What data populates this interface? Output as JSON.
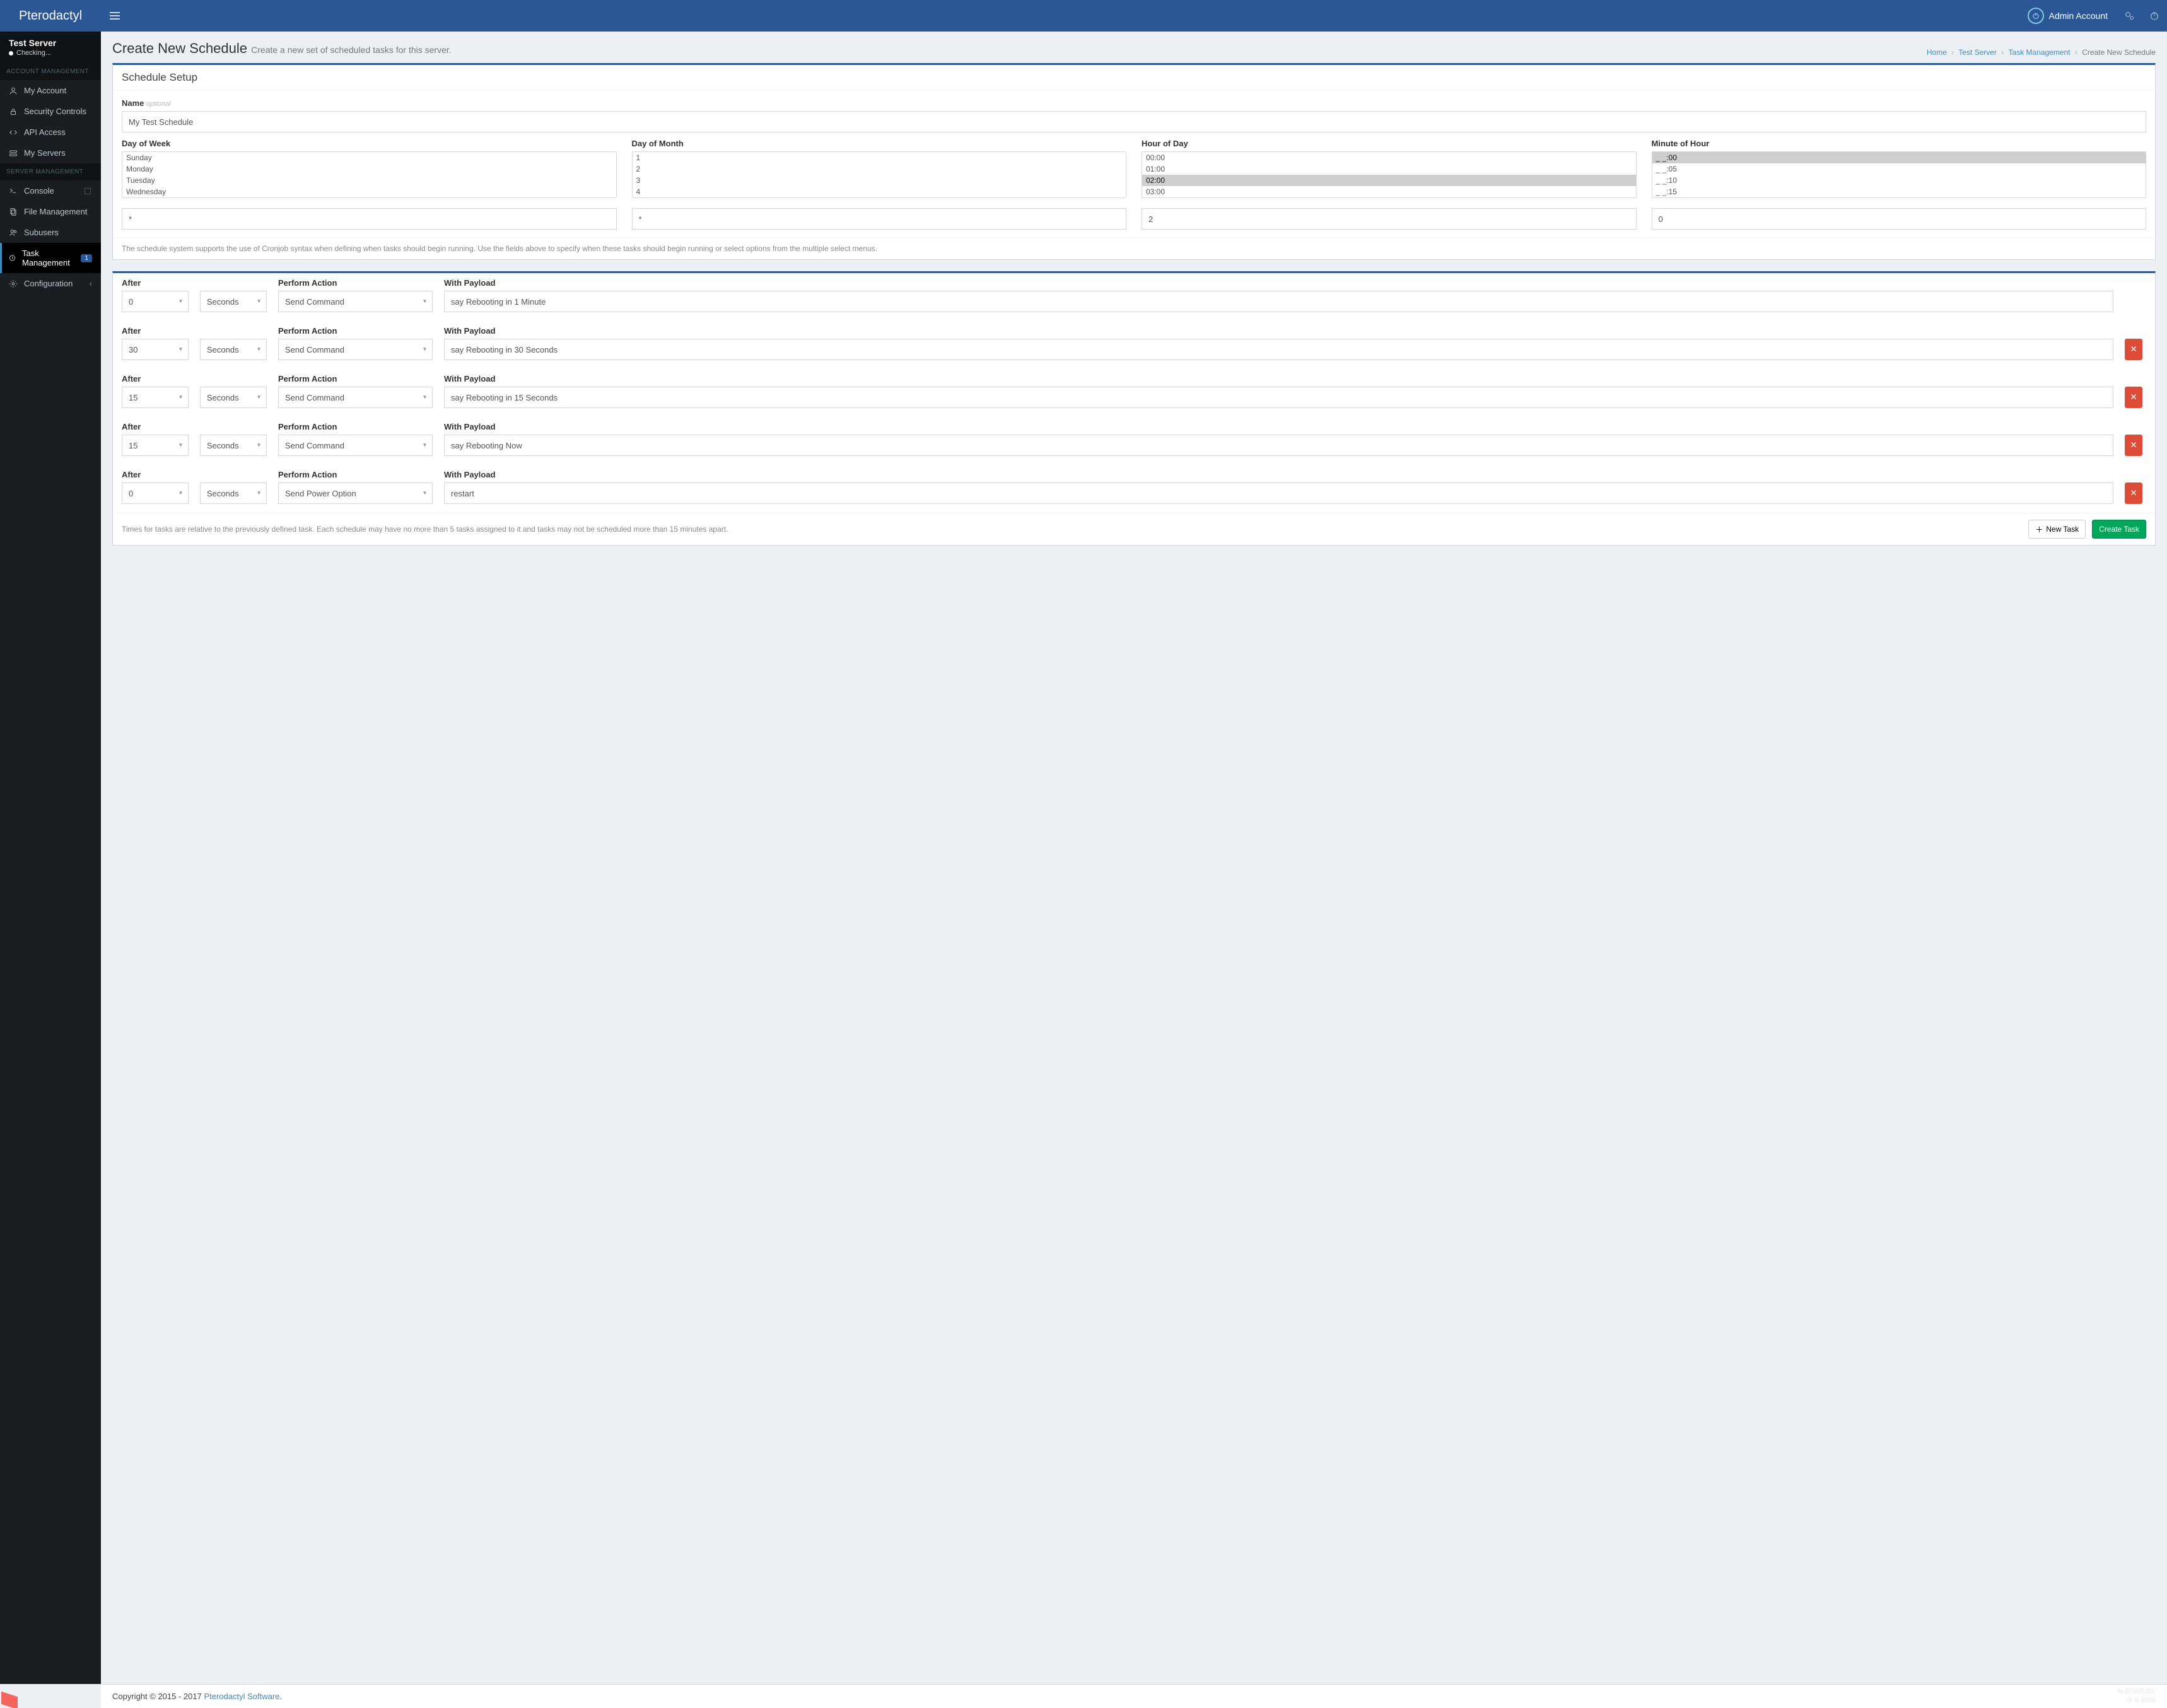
{
  "brand": "Pterodactyl",
  "user": "Admin Account",
  "server": {
    "name": "Test Server",
    "status": "Checking..."
  },
  "side_headers": {
    "account": "ACCOUNT MANAGEMENT",
    "server": "SERVER MANAGEMENT"
  },
  "side": {
    "my_account": "My Account",
    "security": "Security Controls",
    "api": "API Access",
    "servers": "My Servers",
    "console": "Console",
    "files": "File Management",
    "subusers": "Subusers",
    "task": "Task Management",
    "task_badge": "1",
    "config": "Configuration"
  },
  "page": {
    "title": "Create New Schedule",
    "subtitle": "Create a new set of scheduled tasks for this server."
  },
  "breadcrumbs": {
    "home": "Home",
    "server": "Test Server",
    "section": "Task Management",
    "current": "Create New Schedule"
  },
  "setup": {
    "title": "Schedule Setup",
    "name_label": "Name",
    "name_optional": "optional",
    "name_value": "My Test Schedule",
    "dow_label": "Day of Week",
    "dow_options": [
      "Sunday",
      "Monday",
      "Tuesday",
      "Wednesday"
    ],
    "dow_text": "*",
    "dom_label": "Day of Month",
    "dom_options": [
      "1",
      "2",
      "3",
      "4"
    ],
    "dom_text": "*",
    "hour_label": "Hour of Day",
    "hour_options": [
      "00:00",
      "01:00",
      "02:00",
      "03:00"
    ],
    "hour_selected_index": 2,
    "hour_text": "2",
    "minute_label": "Minute of Hour",
    "minute_options": [
      "_ _:00",
      "_ _:05",
      "_ _:10",
      "_ _:15"
    ],
    "minute_selected_index": 0,
    "minute_text": "0",
    "help": "The schedule system supports the use of Cronjob syntax when defining when tasks should begin running. Use the fields above to specify when these tasks should begin running or select options from the multiple select menus."
  },
  "task_labels": {
    "after": "After",
    "action": "Perform Action",
    "payload": "With Payload"
  },
  "tasks": [
    {
      "after_value": "0",
      "after_unit": "Seconds",
      "action": "Send Command",
      "payload": "say Rebooting in 1 Minute",
      "deletable": false
    },
    {
      "after_value": "30",
      "after_unit": "Seconds",
      "action": "Send Command",
      "payload": "say Rebooting in 30 Seconds",
      "deletable": true
    },
    {
      "after_value": "15",
      "after_unit": "Seconds",
      "action": "Send Command",
      "payload": "say Rebooting in 15 Seconds",
      "deletable": true
    },
    {
      "after_value": "15",
      "after_unit": "Seconds",
      "action": "Send Command",
      "payload": "say Rebooting Now",
      "deletable": true
    },
    {
      "after_value": "0",
      "after_unit": "Seconds",
      "action": "Send Power Option",
      "payload": "restart",
      "deletable": true
    }
  ],
  "task_footer": {
    "note": "Times for tasks are relative to the previously defined task. Each schedule may have no more than 5 tasks assigned to it and tasks may not be scheduled more than 15 minutes apart.",
    "new_task": "New Task",
    "submit": "Create Task"
  },
  "footer": {
    "copyright_prefix": "Copyright © 2015 - 2017 ",
    "link": "Pterodactyl Software",
    "stats1": "07955d0c",
    "stats2": "0.409s"
  }
}
